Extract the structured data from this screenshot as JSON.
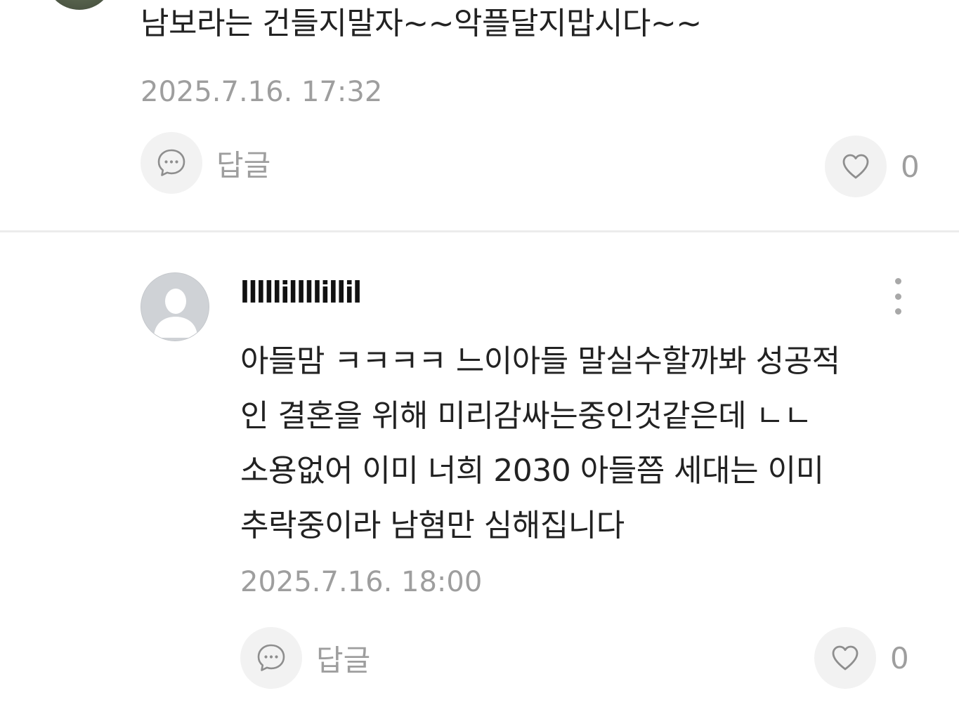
{
  "comments": [
    {
      "text": "남보라는 건들지말자~~악플달지맙시다~~",
      "timestamp": "2025.7.16. 17:32",
      "reply_label": "답글",
      "like_count": "0"
    },
    {
      "author": "lllllillllillil",
      "text_lines": [
        "아들맘 ㅋㅋㅋㅋ 느이아들 말실수할까봐 성공적",
        "인 결혼을 위해 미리감싸는중인것같은데 ㄴㄴ",
        "소용없어 이미 너희 2030 아들쯤 세대는 이미",
        "추락중이라 남혐만 심해집니다"
      ],
      "timestamp": "2025.7.16. 18:00",
      "reply_label": "답글",
      "like_count": "0"
    }
  ],
  "icons": {
    "reply": "chat-bubble-icon",
    "like": "heart-icon",
    "more": "more-vertical-icon",
    "avatar": "default-user-avatar-icon"
  },
  "colors": {
    "text": "#222222",
    "meta": "#9e9e9e",
    "button_bg": "#f2f2f2",
    "divider": "#ececec"
  }
}
